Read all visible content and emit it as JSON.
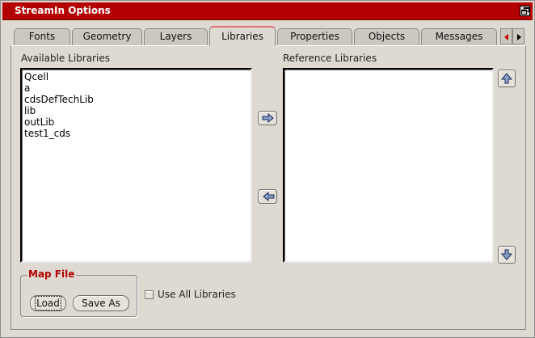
{
  "window": {
    "title": "StreamIn Options"
  },
  "tabs": [
    "Fonts",
    "Geometry",
    "Layers",
    "Libraries",
    "Properties",
    "Objects",
    "Messages"
  ],
  "active_tab": "Libraries",
  "available": {
    "label": "Available Libraries",
    "items": [
      "Qcell",
      "a",
      "cdsDefTechLib",
      "lib",
      "outLib",
      "test1_cds"
    ]
  },
  "reference": {
    "label": "Reference Libraries",
    "items": []
  },
  "map_file": {
    "label": "Map File",
    "load_label": "Load",
    "save_as_label": "Save As"
  },
  "use_all": {
    "label": "Use All Libraries",
    "checked": false
  },
  "colors": {
    "titlebar": "#b40000",
    "accent_text": "#b40000",
    "background": "#dedad2"
  },
  "icons": [
    "restore-icon",
    "arrow-right-icon",
    "arrow-left-icon",
    "arrow-up-icon",
    "arrow-down-icon",
    "scroll-left-icon",
    "scroll-right-icon"
  ]
}
